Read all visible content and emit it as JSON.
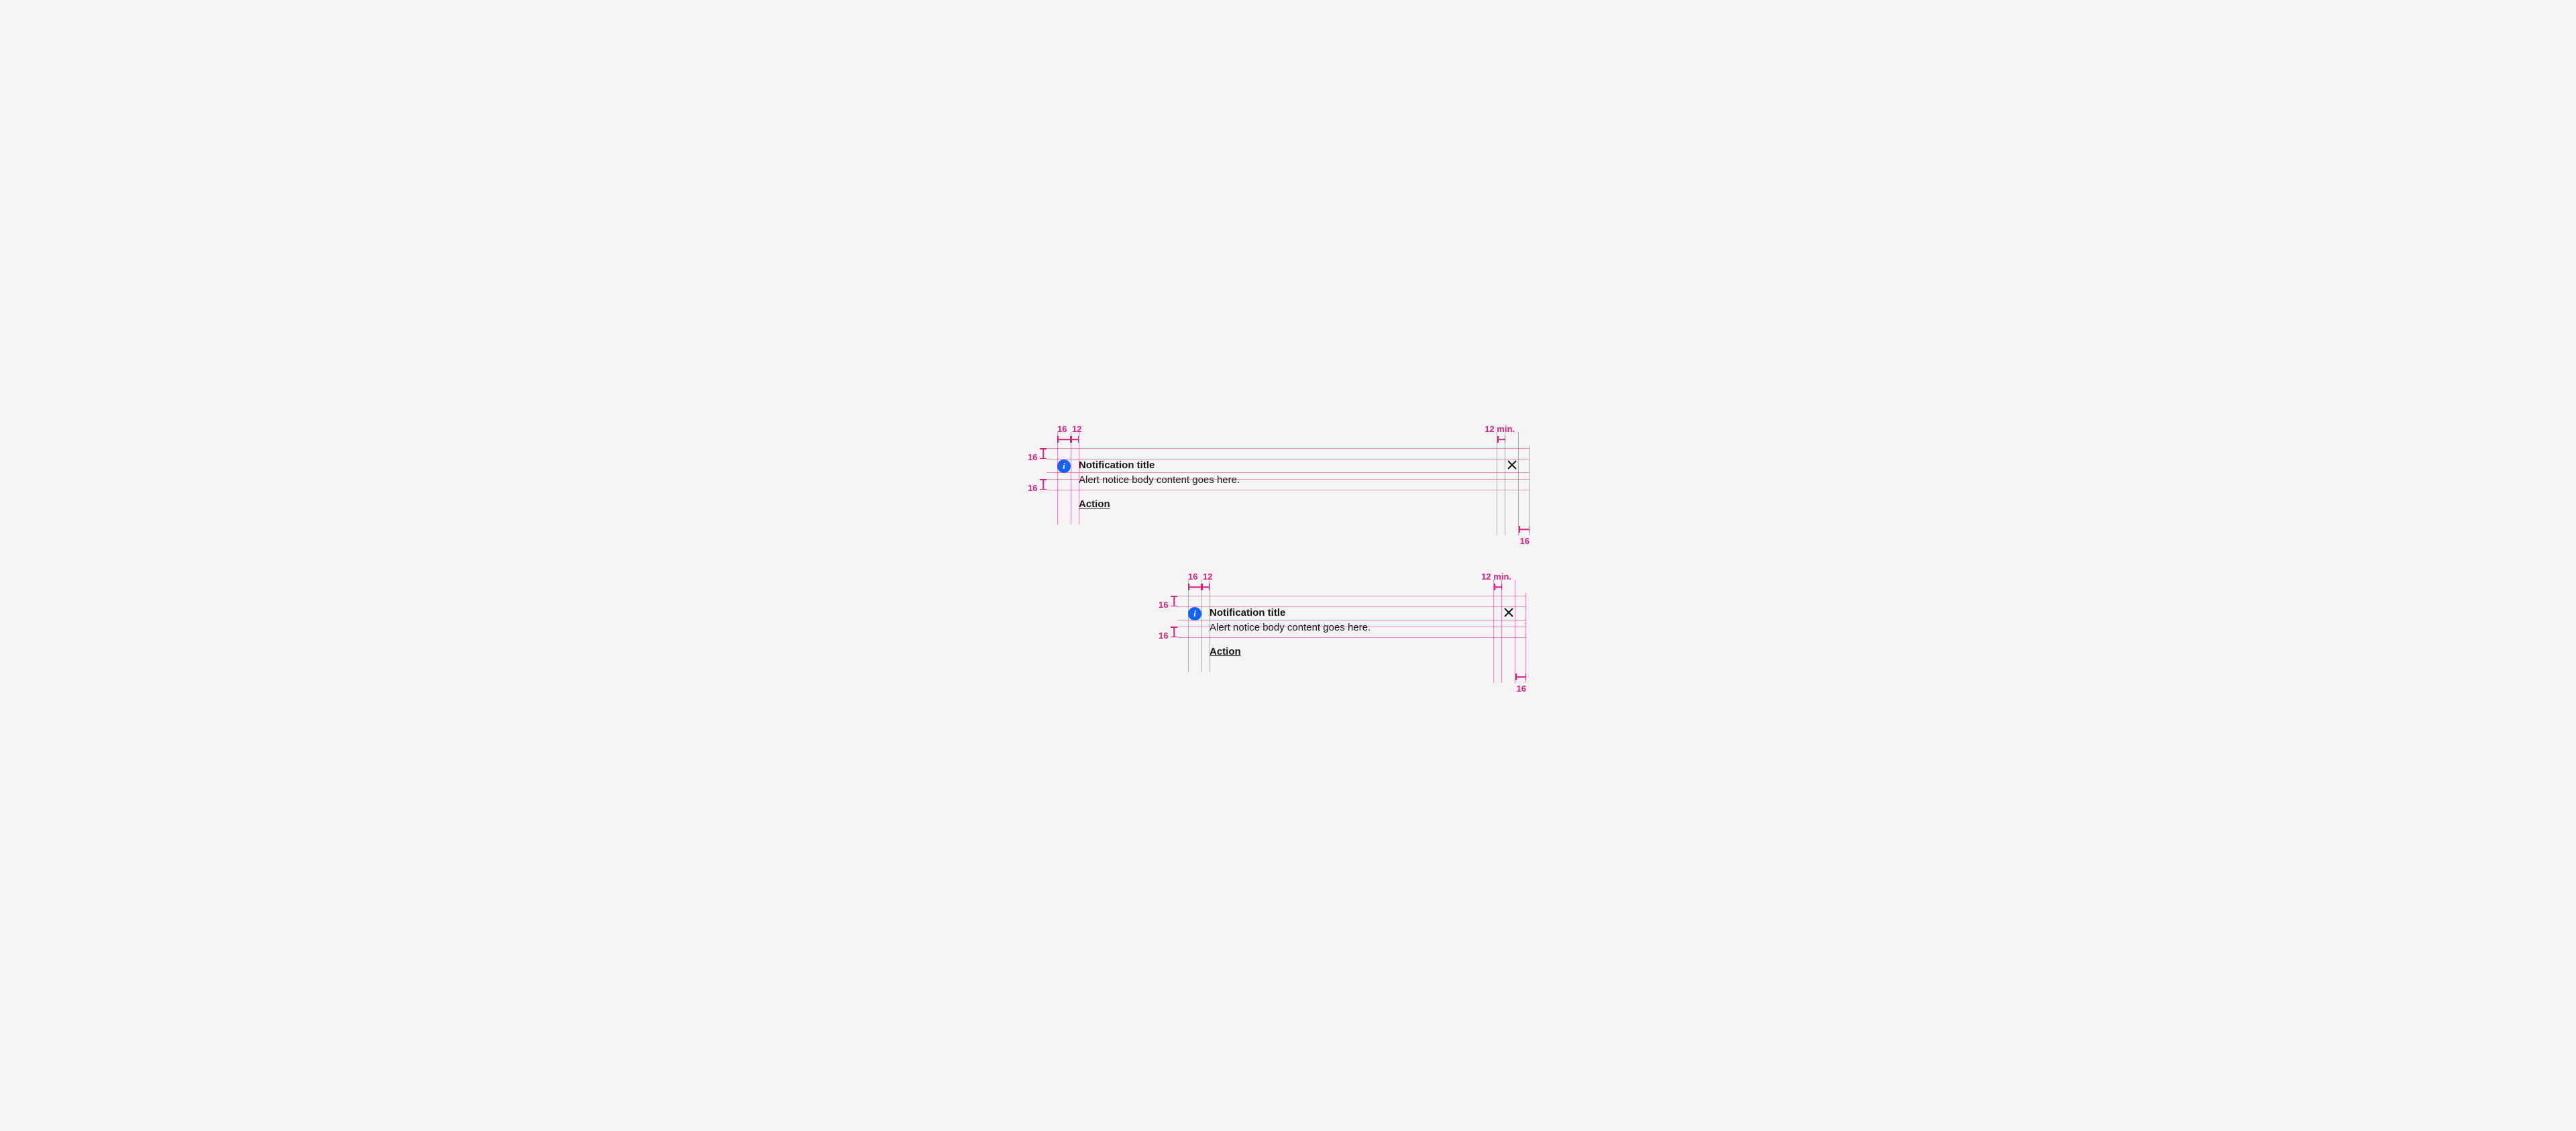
{
  "notification": {
    "title": "Notification title",
    "body": "Alert notice body content goes here.",
    "action_label": "Action"
  },
  "spec": {
    "icon_left_gap": "16",
    "icon_right_gap": "12",
    "top_pad": "16",
    "action_top_gap": "16",
    "close_left_gap": "12 min.",
    "right_pad": "16"
  },
  "colors": {
    "spec": "#da1e82",
    "info_icon": "#0f62fe",
    "text": "#161616"
  }
}
